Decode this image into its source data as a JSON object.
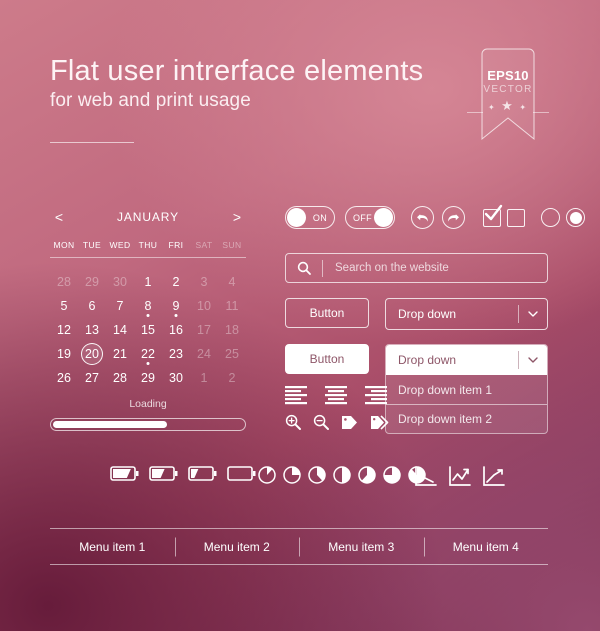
{
  "header": {
    "title": "Flat user intrerface elements",
    "subtitle": "for web and print usage"
  },
  "ribbon": {
    "eps": "EPS10",
    "vector": "VECTOR",
    "stars": "★"
  },
  "calendar": {
    "prev": "<",
    "next": ">",
    "month": "JANUARY",
    "daynames": [
      "MON",
      "TUE",
      "WED",
      "THU",
      "FRI",
      "SAT",
      "SUN"
    ],
    "weeks": [
      [
        {
          "d": "28",
          "muted": true
        },
        {
          "d": "29",
          "muted": true
        },
        {
          "d": "30",
          "muted": true
        },
        {
          "d": "1"
        },
        {
          "d": "2"
        },
        {
          "d": "3",
          "muted": true
        },
        {
          "d": "4",
          "muted": true
        }
      ],
      [
        {
          "d": "5"
        },
        {
          "d": "6"
        },
        {
          "d": "7"
        },
        {
          "d": "8",
          "dot": true
        },
        {
          "d": "9",
          "dot": true
        },
        {
          "d": "10",
          "muted": true
        },
        {
          "d": "11",
          "muted": true
        }
      ],
      [
        {
          "d": "12"
        },
        {
          "d": "13"
        },
        {
          "d": "14"
        },
        {
          "d": "15"
        },
        {
          "d": "16"
        },
        {
          "d": "17",
          "muted": true
        },
        {
          "d": "18",
          "muted": true
        }
      ],
      [
        {
          "d": "19"
        },
        {
          "d": "20",
          "selected": true
        },
        {
          "d": "21"
        },
        {
          "d": "22",
          "dot": true
        },
        {
          "d": "23"
        },
        {
          "d": "24",
          "muted": true
        },
        {
          "d": "25",
          "muted": true
        }
      ],
      [
        {
          "d": "26"
        },
        {
          "d": "27"
        },
        {
          "d": "28"
        },
        {
          "d": "29"
        },
        {
          "d": "30"
        },
        {
          "d": "1",
          "muted": true
        },
        {
          "d": "2",
          "muted": true
        }
      ]
    ]
  },
  "loading": {
    "label": "Loading",
    "percent": 60
  },
  "controls": {
    "toggle_on_label": "ON",
    "toggle_off_label": "OFF",
    "undo_icon": "undo-arrow-icon",
    "redo_icon": "redo-arrow-icon",
    "checkbox_checked_icon": "checkmark-icon",
    "checkbox_unchecked_icon": "empty-checkbox-icon",
    "radio_unselected_icon": "radio-empty-icon",
    "radio_selected_icon": "radio-filled-icon"
  },
  "search": {
    "icon": "search-icon",
    "placeholder": "Search on the website"
  },
  "buttons": {
    "outline_label": "Button",
    "filled_label": "Button"
  },
  "dropdown_collapsed": {
    "label": "Drop down",
    "caret": "chevron-down-icon"
  },
  "dropdown_expanded": {
    "label": "Drop down",
    "caret": "chevron-down-icon",
    "items": [
      "Drop down item 1",
      "Drop down item 2"
    ]
  },
  "icons": {
    "align": [
      "align-left-icon",
      "align-center-icon",
      "align-right-icon"
    ],
    "tools": [
      "zoom-in-icon",
      "zoom-out-icon",
      "tag-icon",
      "tags-icon"
    ]
  },
  "batteries": {
    "levels": [
      85,
      60,
      35,
      0
    ]
  },
  "pies": {
    "levels": [
      12,
      25,
      38,
      50,
      62,
      75,
      88
    ]
  },
  "charts": {
    "icons": [
      "chart-decline-icon",
      "chart-zigzag-icon",
      "chart-rise-icon"
    ]
  },
  "menu": {
    "items": [
      "Menu item 1",
      "Menu item 2",
      "Menu item 3",
      "Menu item 4"
    ]
  },
  "colors": {
    "accent_light": "#cd7b8a",
    "accent_dark": "#722544",
    "text_on_light": "#8e5668",
    "white": "#ffffff"
  }
}
